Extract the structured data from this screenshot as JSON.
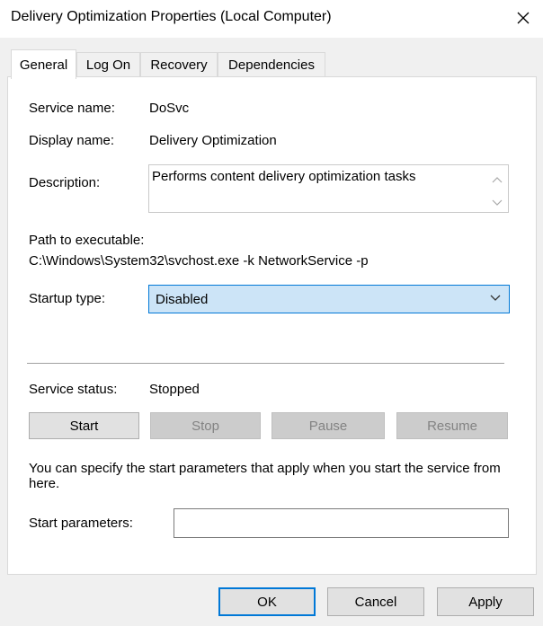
{
  "window": {
    "title": "Delivery Optimization Properties (Local Computer)",
    "close_icon": "close-icon"
  },
  "tabs": [
    {
      "label": "General",
      "active": true
    },
    {
      "label": "Log On",
      "active": false
    },
    {
      "label": "Recovery",
      "active": false
    },
    {
      "label": "Dependencies",
      "active": false
    }
  ],
  "general": {
    "service_name_label": "Service name:",
    "service_name_value": "DoSvc",
    "display_name_label": "Display name:",
    "display_name_value": "Delivery Optimization",
    "description_label": "Description:",
    "description_value": "Performs content delivery optimization tasks",
    "path_label": "Path to executable:",
    "path_value": "C:\\Windows\\System32\\svchost.exe -k NetworkService -p",
    "startup_type_label": "Startup type:",
    "startup_type_value": "Disabled",
    "service_status_label": "Service status:",
    "service_status_value": "Stopped",
    "buttons": {
      "start": "Start",
      "stop": "Stop",
      "pause": "Pause",
      "resume": "Resume"
    },
    "hint_text": "You can specify the start parameters that apply when you start the service from here.",
    "start_parameters_label": "Start parameters:",
    "start_parameters_value": ""
  },
  "footer": {
    "ok": "OK",
    "cancel": "Cancel",
    "apply": "Apply"
  },
  "colors": {
    "accent": "#0078d7",
    "selected_fill": "#cce4f7",
    "disabled_button": "#cccccc"
  }
}
